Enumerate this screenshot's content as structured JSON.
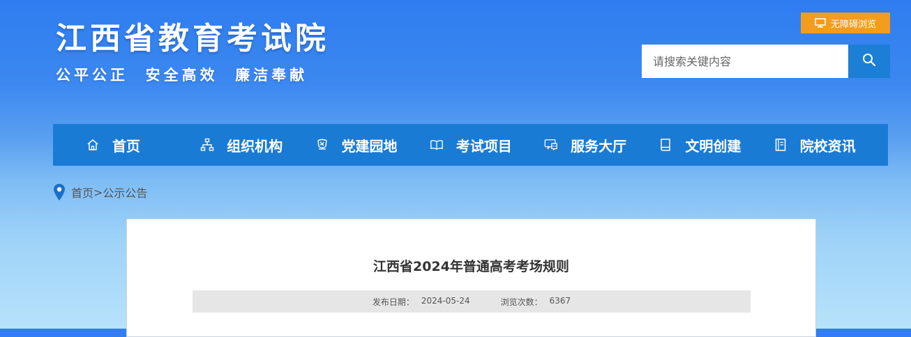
{
  "header": {
    "title": "江西省教育考试院",
    "slogan": "公平公正  安全高效  廉洁奉献",
    "accessibility_label": "无障碍浏览",
    "search": {
      "placeholder": "请搜索关键内容"
    }
  },
  "nav": {
    "items": [
      {
        "label": "首页",
        "icon": "home-icon"
      },
      {
        "label": "组织机构",
        "icon": "org-chart-icon"
      },
      {
        "label": "党建园地",
        "icon": "party-emblem-icon"
      },
      {
        "label": "考试项目",
        "icon": "open-book-icon"
      },
      {
        "label": "服务大厅",
        "icon": "service-chat-icon"
      },
      {
        "label": "文明创建",
        "icon": "book-icon"
      },
      {
        "label": "院校资讯",
        "icon": "news-document-icon"
      }
    ]
  },
  "breadcrumb": {
    "home": "首页",
    "separator": ">",
    "current": "公示公告"
  },
  "article": {
    "title": "江西省2024年普通高考考场规则",
    "publish_label": "发布日期：",
    "publish_date": "2024-05-24",
    "views_label": "浏览次数：",
    "views": "6367"
  },
  "colors": {
    "nav_bg": "#1a7bd5",
    "accessibility_btn": "#f39c1e",
    "search_btn": "#1c7fd6"
  }
}
